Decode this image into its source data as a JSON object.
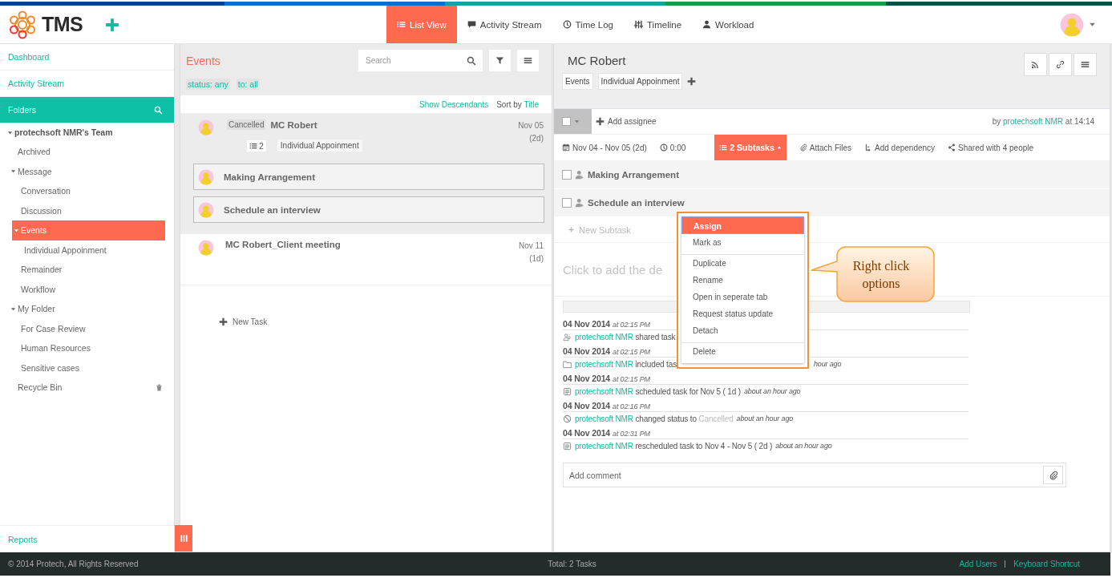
{
  "header": {
    "logo": "TMS",
    "nav": [
      {
        "label": "List View",
        "kind": "list",
        "selected": true
      },
      {
        "label": "Activity Stream",
        "kind": "stream",
        "selected": false
      },
      {
        "label": "Time Log",
        "kind": "clock",
        "selected": false
      },
      {
        "label": "Timeline",
        "kind": "timeline",
        "selected": false
      },
      {
        "label": "Workload",
        "kind": "person",
        "selected": false
      }
    ]
  },
  "sidebar": {
    "links": [
      {
        "label": "Dashboard"
      },
      {
        "label": "Activity Stream"
      }
    ],
    "folders_title": "Folders",
    "tree": [
      {
        "label": "protechsoft NMR's Team",
        "expanded": true,
        "selected": false,
        "children": [
          {
            "label": "Archived",
            "selected": false
          },
          {
            "label": "Message",
            "expanded": true,
            "selected": false,
            "children": [
              {
                "label": "Conversation",
                "selected": false
              },
              {
                "label": "Discussion",
                "selected": false
              },
              {
                "label": "Events",
                "expanded": true,
                "selected": true,
                "children": [
                  {
                    "label": "Individual Appoinment",
                    "selected": false
                  }
                ]
              },
              {
                "label": "Remainder",
                "selected": false
              },
              {
                "label": "Workflow",
                "selected": false
              }
            ]
          },
          {
            "label": "My Folder",
            "expanded": true,
            "selected": false,
            "children": [
              {
                "label": "For Case Review",
                "selected": false
              },
              {
                "label": "Human Resources",
                "selected": false
              },
              {
                "label": "Sensitive cases",
                "selected": false
              }
            ]
          },
          {
            "label": "Recycle Bin",
            "kind": "trash",
            "selected": false
          }
        ]
      }
    ],
    "reports": "Reports"
  },
  "list": {
    "title": "Events",
    "search": {
      "placeholder": "Search"
    },
    "filters": [
      "status: any",
      "to: all"
    ],
    "show_descendants": "Show Descendants",
    "sort_label": "Sort by",
    "sort_value": "Title",
    "tasks": [
      {
        "title": "MC Robert",
        "status": "Cancelled",
        "date": "Nov 05",
        "duration": "(2d)",
        "subtask_count": "2",
        "tag": "Individual Appoinment",
        "selected": true,
        "subtasks": [
          {
            "title": "Making Arrangement"
          },
          {
            "title": "Schedule an interview"
          }
        ]
      },
      {
        "title": "MC Robert_Client meeting",
        "date": "Nov 11",
        "duration": "(1d)",
        "selected": false
      }
    ],
    "new_task": "New Task"
  },
  "detail": {
    "title": "MC Robert",
    "tags": [
      "Events",
      "Individual Appoinment"
    ],
    "checked": false,
    "add_assignee": "Add assignee",
    "by": "by",
    "author": "protechsoft NMR",
    "at": "at 14:14",
    "dates": "Nov 04 - Nov 05 (2d)",
    "time": "0:00",
    "subtasks_button": {
      "label": "2 Subtasks",
      "expanded": true
    },
    "attach": "Attach Files",
    "dependency": "Add dependency",
    "shared": "Shared with 4 people",
    "subtasks": [
      {
        "title": "Making Arrangement",
        "checked": false
      },
      {
        "title": "Schedule an interview",
        "checked": false
      }
    ],
    "new_subtask": "New Subtask",
    "description_placeholder": "Click to add the de",
    "log": [
      {
        "date": "04 Nov 2014",
        "time": "at 02:15 PM",
        "kind": "share",
        "user": "protechsoft NMR",
        "text": "shared task"
      },
      {
        "date": "04 Nov 2014",
        "time": "at 02:15 PM",
        "kind": "folder",
        "user": "protechsoft NMR",
        "text": "included tas",
        "ago": "hour ago"
      },
      {
        "date": "04 Nov 2014",
        "time": "at 02:15 PM",
        "kind": "schedule",
        "user": "protechsoft NMR",
        "text": "scheduled task for Nov 5 ( 1d )",
        "ago": "about an hour ago"
      },
      {
        "date": "04 Nov 2014",
        "time": "at 02:16 PM",
        "kind": "status",
        "user": "protechsoft NMR",
        "text": "changed status to",
        "status": "Cancelled",
        "ago": "about an hour ago"
      },
      {
        "date": "04 Nov 2014",
        "time": "at 02:31 PM",
        "kind": "schedule",
        "user": "protechsoft NMR",
        "text": "rescheduled task to Nov 4 - Nov 5 ( 2d )",
        "ago": "about an hour ago"
      }
    ],
    "comment": {
      "placeholder": "Add comment"
    }
  },
  "context_menu": {
    "groups": [
      {
        "items": [
          {
            "label": "Assign",
            "selected": true
          },
          {
            "label": "Mark as",
            "selected": false
          }
        ]
      },
      {
        "items": [
          {
            "label": "Duplicate",
            "selected": false
          },
          {
            "label": "Rename",
            "selected": false
          },
          {
            "label": "Open in seperate tab",
            "selected": false
          },
          {
            "label": "Request status update",
            "selected": false
          },
          {
            "label": "Detach",
            "selected": false
          }
        ]
      },
      {
        "items": [
          {
            "label": "Delete",
            "selected": false
          }
        ]
      }
    ]
  },
  "callout": {
    "text": "Right click options"
  },
  "footer": {
    "copyright": "© 2014 Protech, All Rights Reserved",
    "total": "Total: 2 Tasks",
    "links": [
      "Add Users",
      "Keyboard Shortcut"
    ]
  }
}
